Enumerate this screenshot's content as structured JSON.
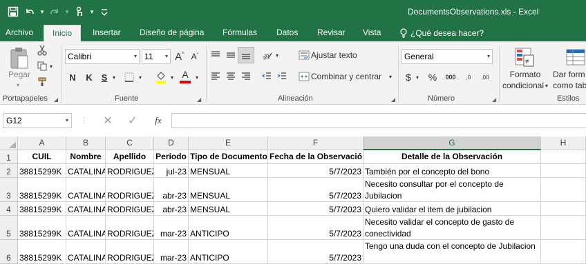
{
  "window": {
    "title": "DocumentsObservations.xls - Excel"
  },
  "qat": {
    "save_icon": "save-icon",
    "undo_icon": "undo-icon",
    "redo_icon": "redo-icon",
    "touch_icon": "touch-mode-icon",
    "customize_icon": "customize-icon"
  },
  "tabs": [
    "Archivo",
    "Inicio",
    "Insertar",
    "Diseño de página",
    "Fórmulas",
    "Datos",
    "Revisar",
    "Vista"
  ],
  "tell_me": "¿Qué desea hacer?",
  "ribbon": {
    "paste_label": "Pegar",
    "clipboard_label": "Portapapeles",
    "font_name": "Calibri",
    "font_size": "11",
    "bold": "N",
    "italic": "K",
    "underline": "S",
    "font_label": "Fuente",
    "wrap_text": "Ajustar texto",
    "merge_center": "Combinar y centrar",
    "alignment_label": "Alineación",
    "number_format": "General",
    "number_label": "Número",
    "cond_format_line1": "Formato",
    "cond_format_line2": "condicional",
    "table_format_line1": "Dar form",
    "table_format_line2": "como tab",
    "styles_label": "Estilos",
    "grow_font": "A",
    "shrink_font": "A",
    "font_color": "A",
    "currency": "$",
    "percent": "%",
    "thousands": "000",
    "inc_decimal": ",0",
    "dec_decimal": ",00"
  },
  "formula_bar": {
    "name_box": "G12",
    "fx": "fx",
    "value": ""
  },
  "sheet": {
    "columns": [
      "A",
      "B",
      "C",
      "D",
      "E",
      "F",
      "G",
      "H"
    ],
    "selected_column": "G",
    "row_numbers": [
      "1",
      "2",
      "3",
      "4",
      "5",
      "6"
    ],
    "headers": [
      "CUIL",
      "Nombre",
      "Apellido",
      "Período",
      "Tipo de Documento",
      "Fecha de la Observación",
      "Detalle de la Observación"
    ],
    "rows": [
      [
        "38815299K",
        "CATALINA",
        "RODRIGUEZ",
        "jul-23",
        "MENSUAL",
        "5/7/2023",
        "También por el concepto del bono"
      ],
      [
        "38815299K",
        "CATALINA",
        "RODRIGUEZ",
        "abr-23",
        "MENSUAL",
        "5/7/2023",
        "Necesito consultar por el concepto de Jubilacion"
      ],
      [
        "38815299K",
        "CATALINA",
        "RODRIGUEZ",
        "abr-23",
        "MENSUAL",
        "5/7/2023",
        "Quiero validar el item de jubilacion"
      ],
      [
        "38815299K",
        "CATALINA",
        "RODRIGUEZ",
        "mar-23",
        "ANTICIPO",
        "5/7/2023",
        "Necesito validar el concepto de gasto de conectividad"
      ],
      [
        "38815299K",
        "CATALINA",
        "RODRIGUEZ",
        "mar-23",
        "ANTICIPO",
        "5/7/2023",
        "Tengo una duda con el concepto de Jubilacion"
      ]
    ]
  },
  "colors": {
    "excel_green": "#217346",
    "ribbon_bg": "#f3f3f3",
    "header_bg": "#efefef",
    "gridline": "#d4d4d4"
  }
}
